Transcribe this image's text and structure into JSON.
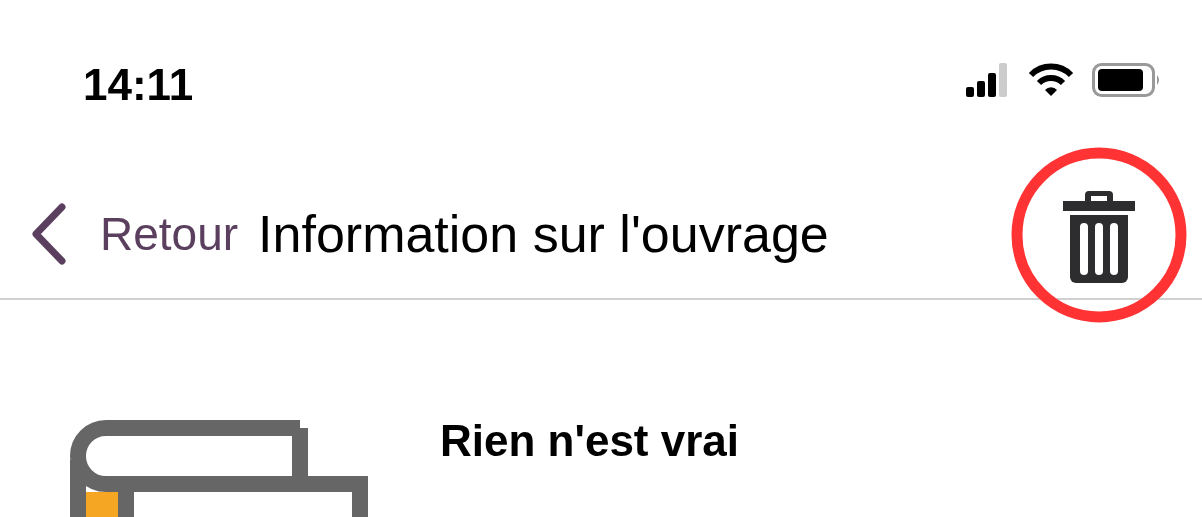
{
  "status_bar": {
    "time": "14:11"
  },
  "nav_bar": {
    "back_label": "Retour",
    "title": "Information sur l'ouvrage",
    "delete_button": {
      "highlighted": true
    }
  },
  "book": {
    "title": "Rien n'est vrai"
  }
}
